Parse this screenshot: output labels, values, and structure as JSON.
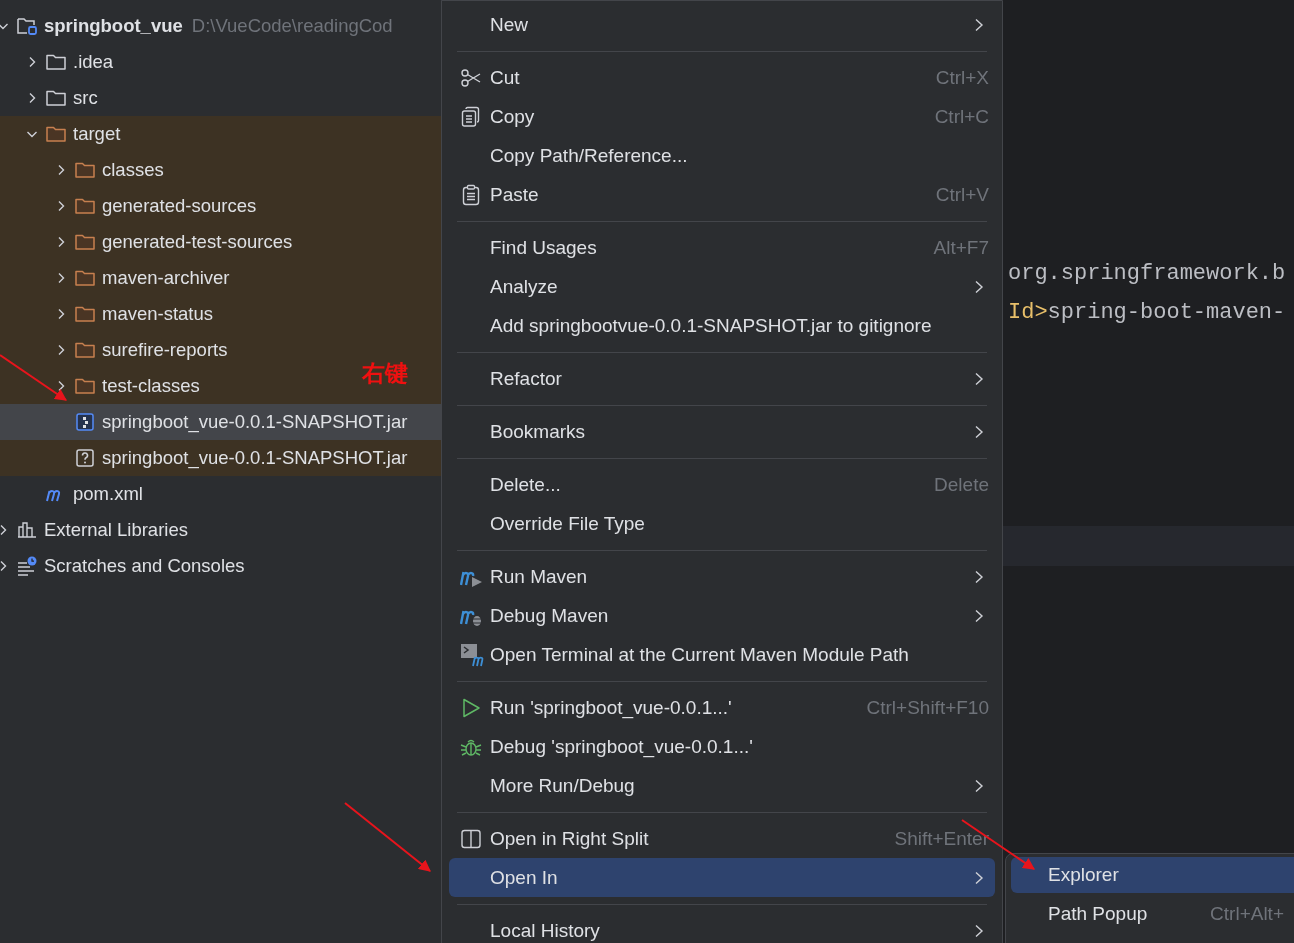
{
  "project_tree": {
    "nodes": [
      {
        "name": "springboot_vue",
        "path": "D:\\VueCode\\readingCod",
        "kind": "project",
        "expanded": true,
        "selected": false,
        "excluded": false,
        "children": [
          {
            "name": ".idea",
            "kind": "folder",
            "expanded": false,
            "selected": false,
            "excluded": false
          },
          {
            "name": "src",
            "kind": "folder",
            "expanded": false,
            "selected": false,
            "excluded": false
          },
          {
            "name": "target",
            "kind": "folder",
            "expanded": true,
            "selected": false,
            "excluded": true,
            "children": [
              {
                "name": "classes",
                "kind": "folder",
                "expanded": false,
                "selected": false,
                "excluded": true
              },
              {
                "name": "generated-sources",
                "kind": "folder",
                "expanded": false,
                "selected": false,
                "excluded": true
              },
              {
                "name": "generated-test-sources",
                "kind": "folder",
                "expanded": false,
                "selected": false,
                "excluded": true
              },
              {
                "name": "maven-archiver",
                "kind": "folder",
                "expanded": false,
                "selected": false,
                "excluded": true
              },
              {
                "name": "maven-status",
                "kind": "folder",
                "expanded": false,
                "selected": false,
                "excluded": true
              },
              {
                "name": "surefire-reports",
                "kind": "folder",
                "expanded": false,
                "selected": false,
                "excluded": true
              },
              {
                "name": "test-classes",
                "kind": "folder",
                "expanded": false,
                "selected": false,
                "excluded": true
              },
              {
                "name": "springboot_vue-0.0.1-SNAPSHOT.jar",
                "kind": "jar",
                "selected": true,
                "excluded": true
              },
              {
                "name": "springboot_vue-0.0.1-SNAPSHOT.jar",
                "kind": "unknown",
                "selected": false,
                "excluded": true
              }
            ]
          },
          {
            "name": "pom.xml",
            "kind": "maven",
            "selected": false,
            "excluded": false
          }
        ]
      },
      {
        "name": "External Libraries",
        "kind": "libraries",
        "expanded": false,
        "selected": false,
        "excluded": false
      },
      {
        "name": "Scratches and Consoles",
        "kind": "scratches",
        "expanded": false,
        "selected": false,
        "excluded": false
      }
    ]
  },
  "editor": {
    "lines": [
      {
        "segments": [
          {
            "text": "org.springframework.b",
            "kind": "plain"
          }
        ]
      },
      {
        "segments": [
          {
            "text": "Id>",
            "kind": "tag"
          },
          {
            "text": "spring-boot-maven-",
            "kind": "plain"
          }
        ]
      }
    ]
  },
  "context_menu": {
    "groups": [
      {
        "items": [
          {
            "label": "New",
            "kind": "plain",
            "has_submenu": true,
            "selected": false
          }
        ]
      },
      {
        "items": [
          {
            "label": "Cut",
            "kind": "cut",
            "shortcut": "Ctrl+X",
            "has_submenu": false,
            "selected": false
          },
          {
            "label": "Copy",
            "kind": "copy",
            "shortcut": "Ctrl+C",
            "has_submenu": false,
            "selected": false
          },
          {
            "label": "Copy Path/Reference...",
            "kind": "plain",
            "has_submenu": false,
            "selected": false
          },
          {
            "label": "Paste",
            "kind": "paste",
            "shortcut": "Ctrl+V",
            "has_submenu": false,
            "selected": false
          }
        ]
      },
      {
        "items": [
          {
            "label": "Find Usages",
            "kind": "plain",
            "shortcut": "Alt+F7",
            "has_submenu": false,
            "selected": false
          },
          {
            "label": "Analyze",
            "kind": "plain",
            "has_submenu": true,
            "selected": false
          },
          {
            "label": "Add springbootvue-0.0.1-SNAPSHOT.jar to gitignore",
            "kind": "plain",
            "has_submenu": false,
            "selected": false
          }
        ]
      },
      {
        "items": [
          {
            "label": "Refactor",
            "kind": "plain",
            "has_submenu": true,
            "selected": false
          }
        ]
      },
      {
        "items": [
          {
            "label": "Bookmarks",
            "kind": "plain",
            "has_submenu": true,
            "selected": false
          }
        ]
      },
      {
        "items": [
          {
            "label": "Delete...",
            "kind": "plain",
            "shortcut": "Delete",
            "has_submenu": false,
            "selected": false
          },
          {
            "label": "Override File Type",
            "kind": "plain",
            "has_submenu": false,
            "selected": false
          }
        ]
      },
      {
        "items": [
          {
            "label": "Run Maven",
            "kind": "maven-run",
            "has_submenu": true,
            "selected": false
          },
          {
            "label": "Debug Maven",
            "kind": "maven-debug",
            "has_submenu": true,
            "selected": false
          },
          {
            "label": "Open Terminal at the Current Maven Module Path",
            "kind": "terminal",
            "has_submenu": false,
            "selected": false
          }
        ]
      },
      {
        "items": [
          {
            "label": "Run 'springboot_vue-0.0.1...'",
            "kind": "run",
            "shortcut": "Ctrl+Shift+F10",
            "has_submenu": false,
            "selected": false
          },
          {
            "label": "Debug 'springboot_vue-0.0.1...'",
            "kind": "debug",
            "has_submenu": false,
            "selected": false
          },
          {
            "label": "More Run/Debug",
            "kind": "plain",
            "has_submenu": true,
            "selected": false
          }
        ]
      },
      {
        "items": [
          {
            "label": "Open in Right Split",
            "kind": "split",
            "shortcut": "Shift+Enter",
            "has_submenu": false,
            "selected": false
          },
          {
            "label": "Open In",
            "kind": "plain",
            "has_submenu": true,
            "selected": true
          }
        ]
      },
      {
        "items": [
          {
            "label": "Local History",
            "kind": "plain",
            "has_submenu": true,
            "selected": false
          }
        ]
      }
    ]
  },
  "submenu": {
    "items": [
      {
        "label": "Explorer",
        "selected": true
      },
      {
        "label": "Path Popup",
        "shortcut": "Ctrl+Alt+",
        "selected": false
      }
    ]
  },
  "annotations": [
    {
      "text": "右键"
    }
  ]
}
